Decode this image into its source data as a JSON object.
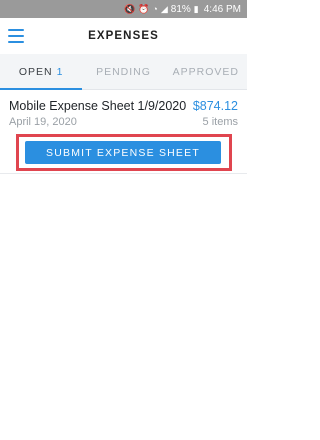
{
  "status_bar": {
    "battery": "81%",
    "time": "4:46 PM",
    "icons": [
      "mute-icon",
      "alarm-icon",
      "wifi-icon",
      "signal-icon",
      "battery-icon"
    ]
  },
  "header": {
    "title": "EXPENSES",
    "menu_icon": "hamburger-menu-icon"
  },
  "tabs": [
    {
      "label": "OPEN",
      "count": "1",
      "active": true
    },
    {
      "label": "PENDING",
      "active": false
    },
    {
      "label": "APPROVED",
      "active": false
    }
  ],
  "expenses": [
    {
      "title": "Mobile Expense Sheet 1/9/2020",
      "amount": "$874.12",
      "date": "April 19, 2020",
      "items": "5 items",
      "action_label": "SUBMIT EXPENSE SHEET"
    }
  ],
  "colors": {
    "accent": "#2b8fe0",
    "highlight": "#e0454f",
    "status_bar": "#9a9a9a"
  }
}
